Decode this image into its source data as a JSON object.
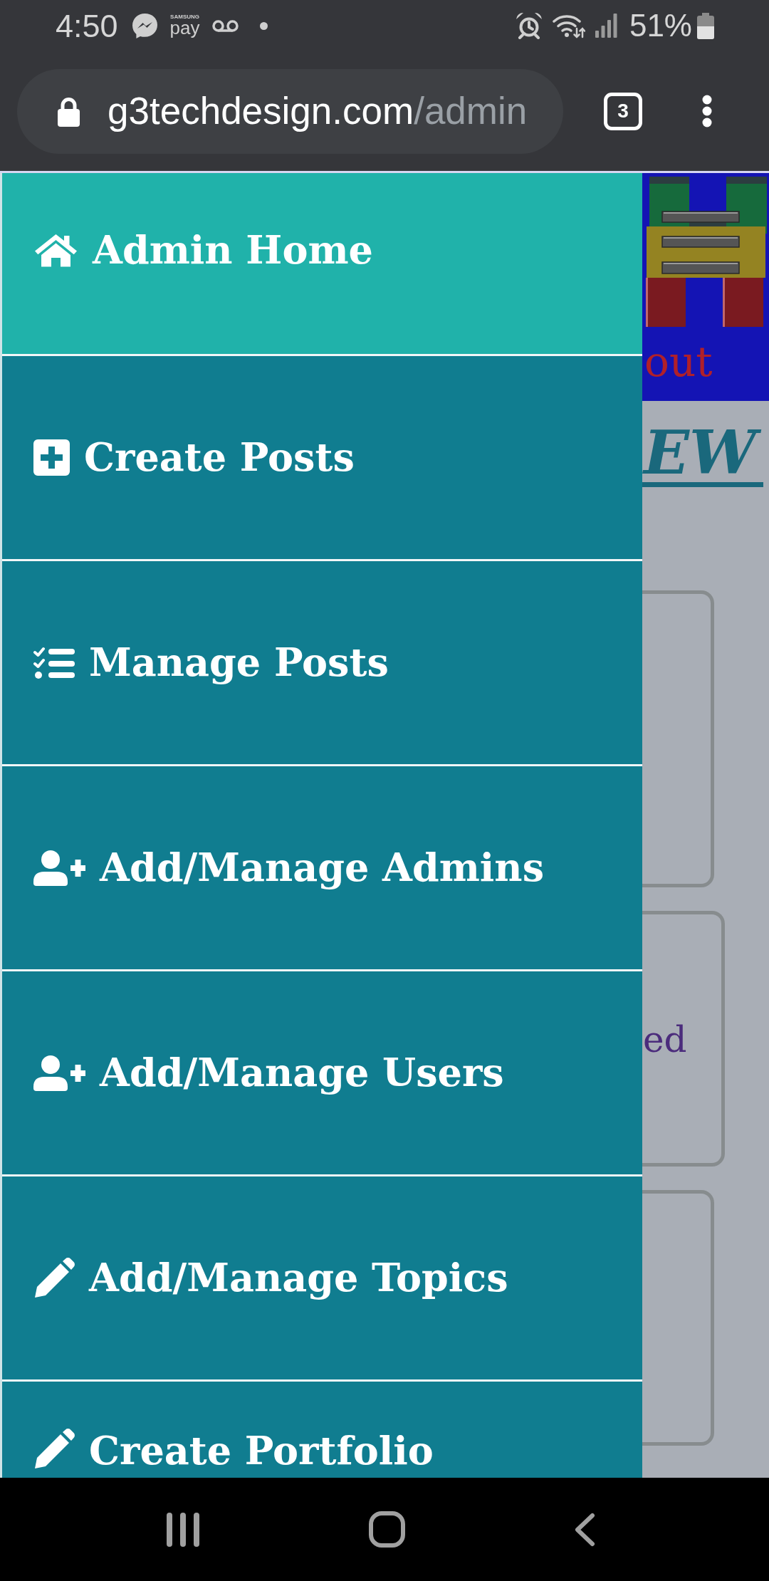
{
  "status_bar": {
    "time": "4:50",
    "notifications": [
      {
        "kind": "messenger"
      },
      {
        "kind": "pay",
        "brand": "SAMSUNG",
        "label": "pay"
      },
      {
        "kind": "voicemail"
      },
      {
        "kind": "dot"
      }
    ],
    "system_icons": [
      {
        "kind": "alarm"
      },
      {
        "kind": "wifi"
      },
      {
        "kind": "signal"
      }
    ],
    "battery_text": "51%"
  },
  "browser_bar": {
    "url_domain": "g3techdesign.com",
    "url_path": "/admin",
    "tab_count": "3"
  },
  "menu": {
    "items": [
      {
        "kind": "home",
        "label": "Admin Home",
        "selected": true
      },
      {
        "kind": "plus-square",
        "label": "Create Posts",
        "selected": false
      },
      {
        "kind": "tasks",
        "label": "Manage Posts",
        "selected": false
      },
      {
        "kind": "user-plus",
        "label": "Add/Manage Admins",
        "selected": false
      },
      {
        "kind": "user-plus",
        "label": "Add/Manage Users",
        "selected": false
      },
      {
        "kind": "pencil",
        "label": "Add/Manage Topics",
        "selected": false
      },
      {
        "kind": "pencil",
        "label": "Create Portfolio",
        "selected": false
      }
    ]
  },
  "page": {
    "header_link": "out",
    "heading": "EW",
    "cards": [
      {
        "kind": "blank"
      },
      {
        "kind": "text",
        "text": "ed"
      },
      {
        "kind": "blank"
      }
    ]
  },
  "navigation_bar": {
    "buttons": [
      {
        "kind": "recents"
      },
      {
        "kind": "home"
      },
      {
        "kind": "back"
      }
    ]
  }
}
